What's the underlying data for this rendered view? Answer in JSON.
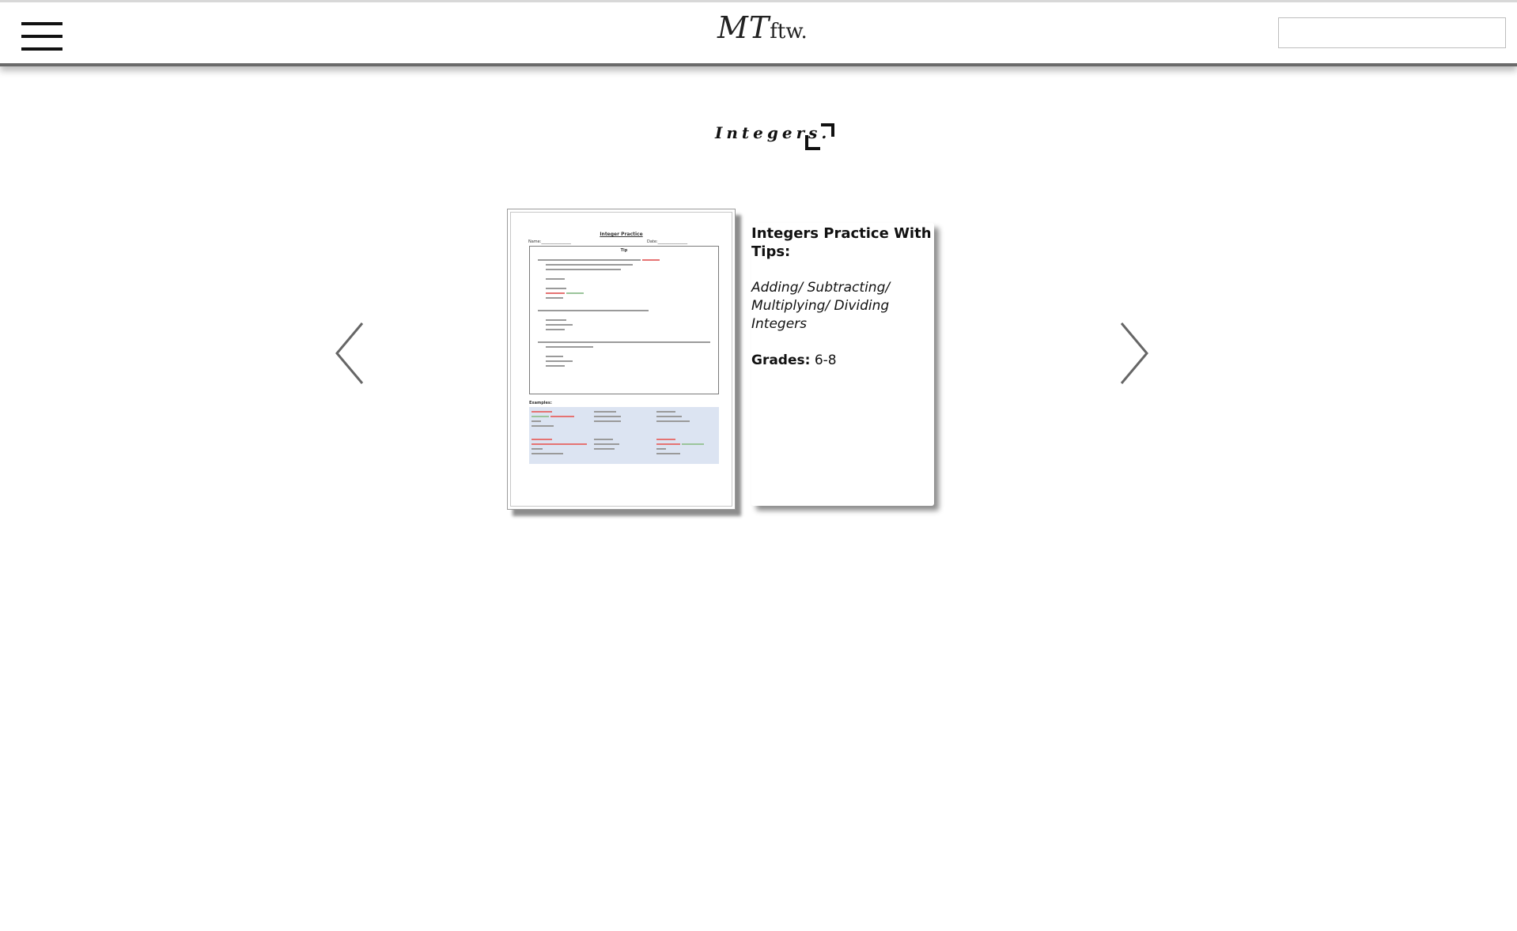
{
  "header": {
    "logo_main": "MT",
    "logo_sub": "ftw.",
    "search": {
      "value": "",
      "placeholder": ""
    }
  },
  "page": {
    "title": "Integers."
  },
  "carousel": {
    "document": {
      "title": "Integer Practice",
      "name_label": "Name:_______________",
      "date_label": "Date:_______________",
      "tip_heading": "Tip",
      "examples_label": "Examples:"
    },
    "card": {
      "title": "Integers Practice With Tips:",
      "subtitle": "Adding/ Subtracting/ Multiplying/ Dividing Integers",
      "grades_label": "Grades:",
      "grades_value": "6-8"
    }
  },
  "icons": {
    "menu": "hamburger-icon",
    "fullscreen": "fullscreen-icon",
    "prev": "chevron-left-icon",
    "next": "chevron-right-icon"
  },
  "colors": {
    "header_shadow": "#6a6a6a",
    "example_table_bg": "#dce4f2",
    "arrow": "#666666"
  }
}
